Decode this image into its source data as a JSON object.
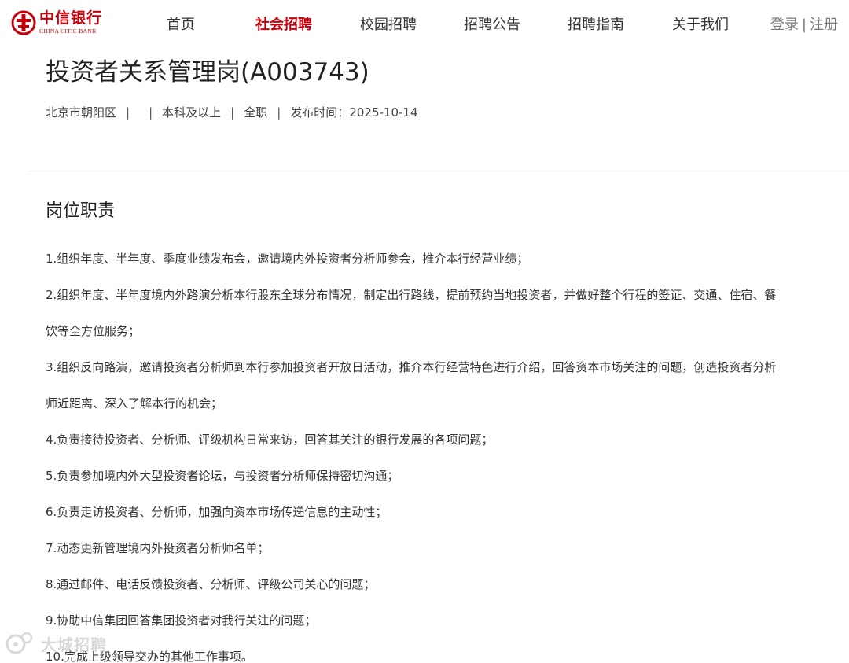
{
  "brand": {
    "name_cn": "中信银行",
    "name_en": "CHINA CITIC BANK",
    "color": "#c7000b"
  },
  "nav": {
    "items": [
      {
        "label": "首页"
      },
      {
        "label": "社会招聘",
        "active": true
      },
      {
        "label": "校园招聘"
      },
      {
        "label": "招聘公告"
      },
      {
        "label": "招聘指南"
      },
      {
        "label": "关于我们"
      }
    ],
    "login": "登录",
    "separator": "|",
    "register": "注册"
  },
  "job": {
    "title": "投资者关系管理岗(A003743)",
    "location": "北京市朝阳区",
    "separator": "|",
    "education": "本科及以上",
    "type": "全职",
    "publish_label": "发布时间：",
    "publish_date": "2025-10-14"
  },
  "responsibilities": {
    "title": "岗位职责",
    "items": [
      "1.组织年度、半年度、季度业绩发布会，邀请境内外投资者分析师参会，推介本行经营业绩；",
      "2.组织年度、半年度境内外路演分析本行股东全球分布情况，制定出行路线，提前预约当地投资者，并做好整个行程的签证、交通、住宿、餐",
      "饮等全方位服务；",
      "3.组织反向路演，邀请投资者分析师到本行参加投资者开放日活动，推介本行经营特色进行介绍，回答资本市场关注的问题，创造投资者分析",
      "师近距离、深入了解本行的机会；",
      "4.负责接待投资者、分析师、评级机构日常来访，回答其关注的银行发展的各项问题；",
      "5.负责参加境内外大型投资者论坛，与投资者分析师保持密切沟通；",
      "6.负责走访投资者、分析师，加强向资本市场传递信息的主动性；",
      "7.动态更新管理境内外投资者分析师名单；",
      "8.通过邮件、电话反馈投资者、分析师、评级公司关心的问题；",
      "9.协助中信集团回答集团投资者对我行关注的问题；",
      "10.完成上级领导交办的其他工作事项。"
    ]
  },
  "watermark": {
    "text": "大城招聘"
  }
}
